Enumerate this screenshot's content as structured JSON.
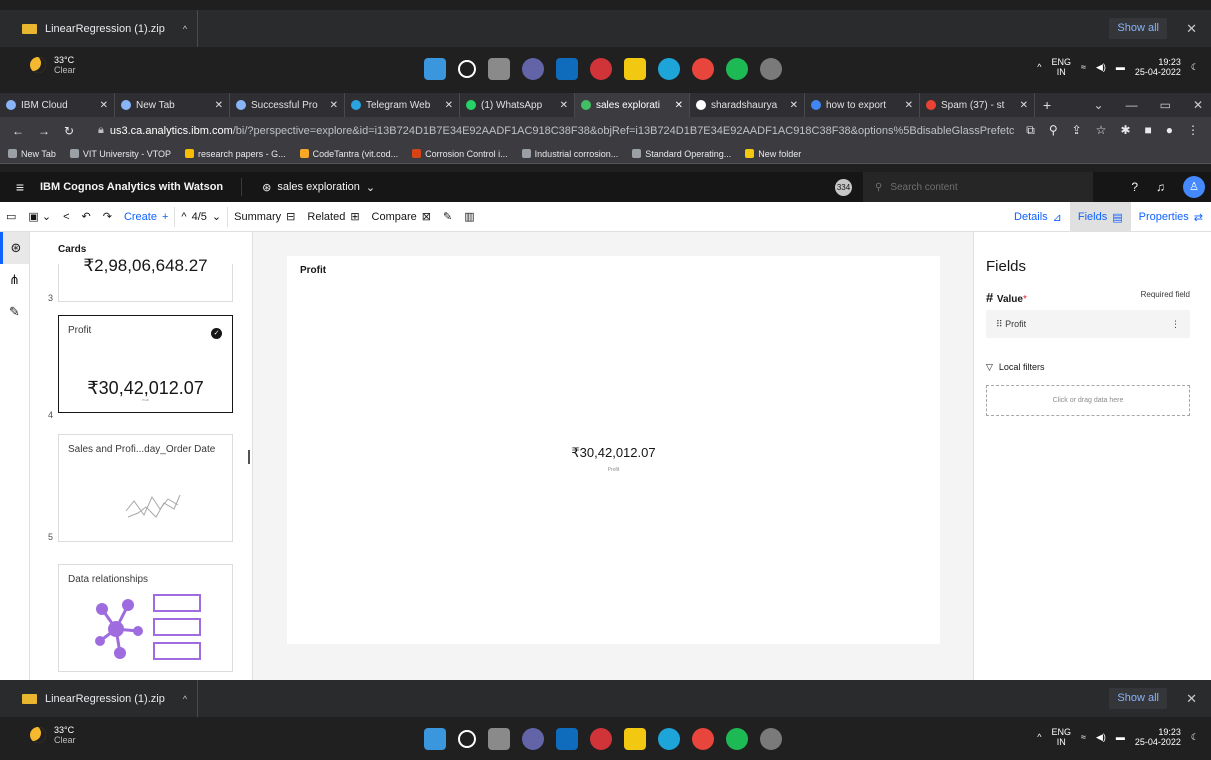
{
  "downloads": {
    "file": "LinearRegression (1).zip",
    "show_all": "Show all"
  },
  "weather": {
    "temp": "33°C",
    "cond": "Clear"
  },
  "tray": {
    "lang1": "ENG",
    "lang2": "IN",
    "time": "19:23",
    "date": "25-04-2022"
  },
  "tabs": [
    {
      "label": "IBM Cloud"
    },
    {
      "label": "New Tab"
    },
    {
      "label": "Successful Pro"
    },
    {
      "label": "Telegram Web"
    },
    {
      "label": "(1) WhatsApp"
    },
    {
      "label": "sales explorati"
    },
    {
      "label": "sharadshaurya"
    },
    {
      "label": "how to export"
    },
    {
      "label": "Spam (37) - st"
    }
  ],
  "address": {
    "domain": "us3.ca.analytics.ibm.com",
    "path": "/bi/?perspective=explore&id=i13B724D1B7E34E92AADF1AC918C38F38&objRef=i13B724D1B7E34E92AADF1AC918C38F38&options%5BdisableGlassPrefetc..."
  },
  "bookmarks": [
    "New Tab",
    "VIT University - VTOP",
    "research papers - G...",
    "CodeTantra (vit.cod...",
    "Corrosion Control i...",
    "Industrial corrosion...",
    "Standard Operating...",
    "New folder"
  ],
  "cognos": {
    "brand": "IBM Cognos Analytics with Watson",
    "report": "sales exploration",
    "badge": "334",
    "search_placeholder": "Search content"
  },
  "toolbar": {
    "create": "Create",
    "page": "4/5",
    "summary": "Summary",
    "related": "Related",
    "compare": "Compare",
    "details": "Details",
    "fields": "Fields",
    "properties": "Properties"
  },
  "cards": {
    "header": "Cards",
    "c3": {
      "num": "3",
      "value": "₹2,98,06,648.27"
    },
    "c4": {
      "num": "4",
      "title": "Profit",
      "value": "₹30,42,012.07",
      "sub": "Profit"
    },
    "c5": {
      "num": "5",
      "title": "Sales and Profi...day_Order Date"
    },
    "c6": {
      "title": "Data relationships"
    }
  },
  "canvas": {
    "title": "Profit",
    "value": "₹30,42,012.07",
    "label": "Profit"
  },
  "fields_panel": {
    "heading": "Fields",
    "value_label": "Value",
    "required": "Required field",
    "slot": "Profit",
    "local_filters": "Local filters",
    "drop_hint": "Click or drag data here"
  }
}
